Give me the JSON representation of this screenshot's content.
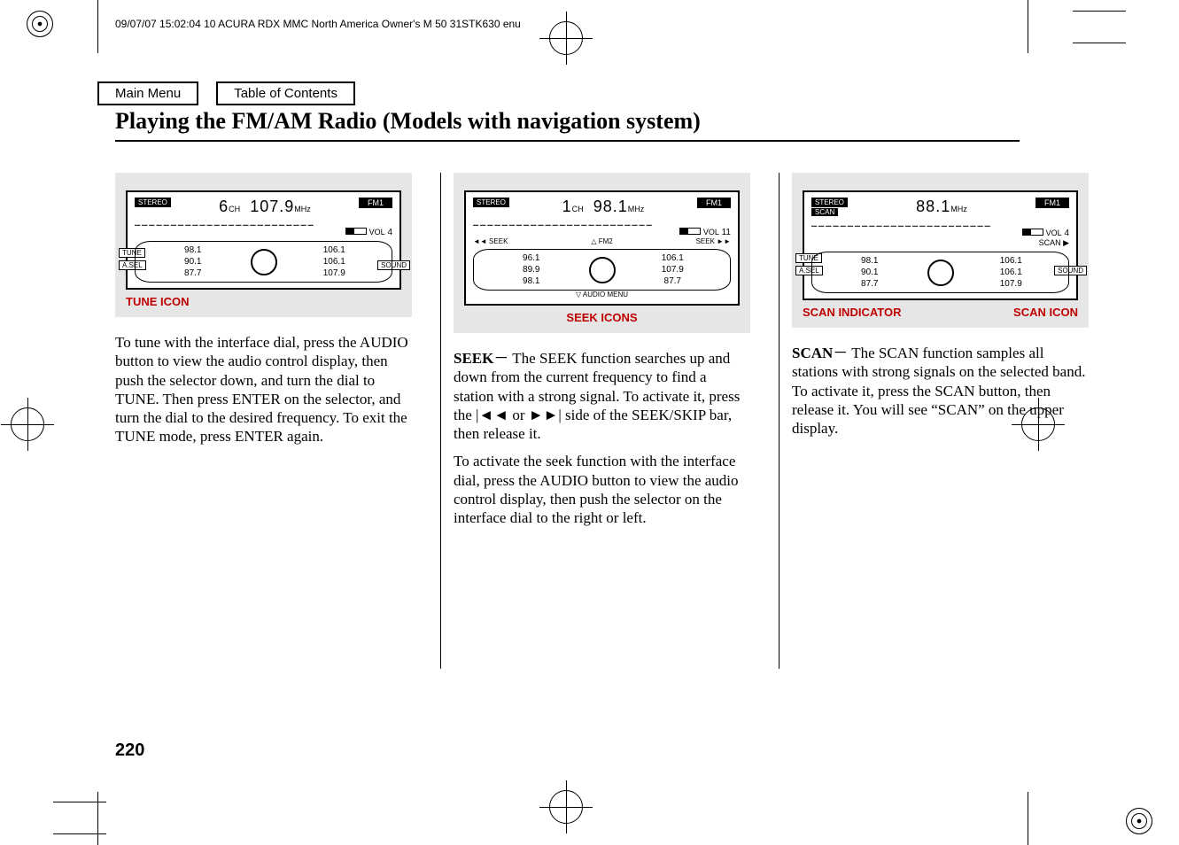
{
  "meta": {
    "header_line": "09/07/07 15:02:04    10 ACURA RDX MMC North America Owner's M 50 31STK630 enu"
  },
  "nav": {
    "main_menu": "Main Menu",
    "toc": "Table of Contents"
  },
  "title": "Playing the FM/AM Radio (Models with navigation system)",
  "page_number": "220",
  "col1": {
    "caption": "TUNE ICON",
    "display": {
      "stereo": "STEREO",
      "band": "FM1",
      "channel_num": "6",
      "channel_unit": "CH",
      "freq": "107.9",
      "freq_unit": "MHz",
      "vol_label": "VOL",
      "vol_value": "4",
      "side_tune": "TUNE",
      "side_asel": "A.SEL",
      "side_sound": "SOUND",
      "presets": {
        "p1": "87.7",
        "p2": "90.1",
        "p3": "98.1",
        "p4": "106.1",
        "p5": "106.1",
        "p6": "107.9"
      }
    },
    "text": "To tune with the interface dial, press the AUDIO button to view the audio control display, then push the selector down, and turn the dial to TUNE. Then press ENTER on the selector, and turn the dial to the desired frequency. To exit the TUNE mode, press ENTER again."
  },
  "col2": {
    "caption": "SEEK ICONS",
    "display": {
      "stereo": "STEREO",
      "band": "FM1",
      "channel_num": "1",
      "channel_unit": "CH",
      "freq": "98.1",
      "freq_unit": "MHz",
      "vol_label": "VOL",
      "vol_value": "11",
      "seek_l": "◄◄ SEEK",
      "fm2": "△ FM2",
      "seek_r": "SEEK ►►",
      "audio_menu": "▽ AUDIO MENU",
      "presets": {
        "p1": "98.1",
        "p2": "89.9",
        "p3": "96.1",
        "p4": "106.1",
        "p5": "107.9",
        "p6": "87.7"
      }
    },
    "heading": "SEEK",
    "text1": "－ The SEEK function searches up and down from the current frequency to find a station with a strong signal. To activate it, press the |◄◄ or ►►| side of the SEEK/SKIP bar, then release it.",
    "text2": "To activate the seek function with the interface dial, press the AUDIO button to view the audio control display, then push the selector on the interface dial to the right or left."
  },
  "col3": {
    "caption_left": "SCAN INDICATOR",
    "caption_right": "SCAN ICON",
    "display": {
      "stereo": "STEREO",
      "scan_indicator": "SCAN",
      "band": "FM1",
      "freq": "88.1",
      "freq_unit": "MHz",
      "vol_label": "VOL",
      "vol_value": "4",
      "scan_icon": "SCAN ▶",
      "side_tune": "TUNE",
      "side_asel": "A.SEL",
      "side_sound": "SOUND",
      "presets": {
        "p1": "87.7",
        "p2": "90.1",
        "p3": "98.1",
        "p4": "106.1",
        "p5": "106.1",
        "p6": "107.9"
      }
    },
    "heading": "SCAN",
    "text": "－ The SCAN function samples all stations with strong signals on the selected band. To activate it, press the SCAN button, then release it. You will see “SCAN” on the upper display."
  }
}
